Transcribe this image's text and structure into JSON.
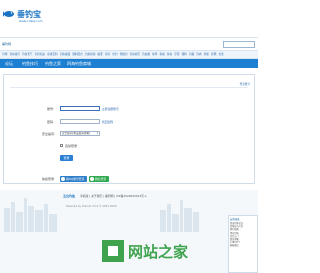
{
  "site": {
    "logo_text": "垂钓宝",
    "logo_url": "www.cdsky.com",
    "top_left": "垂钓网"
  },
  "subnav": [
    "钓场",
    "钓鱼技巧",
    "钓鱼天气",
    "钓具知识",
    "鱼类百科",
    "钓鱼视频",
    "饵料配方",
    "钓鱼新闻",
    "路亚",
    "海钓",
    "台钓",
    "传统钓",
    "钓鱼社区",
    "钓友圈",
    "鱼竿",
    "鱼线",
    "鱼钩",
    "浮漂",
    "饵料",
    "钓箱",
    "钓椅",
    "渔轮",
    "抄网",
    "支架"
  ],
  "mainnav": [
    {
      "label": "论坛"
    },
    {
      "label": "钓鱼技巧"
    },
    {
      "label": "钓鱼之家"
    },
    {
      "label": "四海钓鱼商城"
    }
  ],
  "breadcrumb": "登录账号",
  "form": {
    "username_label": "账号:",
    "username_link": "立即注册账号",
    "password_label": "密码:",
    "password_link": "找回密码",
    "security_label": "安全提问:",
    "security_select": "安全提问(未设置请忽略)",
    "remember_label": "自动登录",
    "submit_label": "登录",
    "quick_label": "快捷登录:",
    "qq_label": "用QQ账号登录",
    "wx_label": "微信登录"
  },
  "footer": {
    "logo": "五台钓鱼",
    "links": "手机版 | 关于我们 | 垂钓网 | ICP备2020042013号-1",
    "copy": "Powered by Discuz! X3.4 © 2001-2020"
  },
  "side_panel": {
    "title": "友情链接",
    "lines": [
      "四海钓鱼论坛",
      "钓鱼技巧大全",
      "野钓攻略",
      "黑坑钓鱼",
      "台钓入门",
      "联系邮箱",
      "1380177",
      "客服微信"
    ]
  },
  "colors": {
    "nav_blue": "#1d7fd1",
    "qq_blue": "#2f7fc8",
    "wx_green": "#2fa84f"
  }
}
